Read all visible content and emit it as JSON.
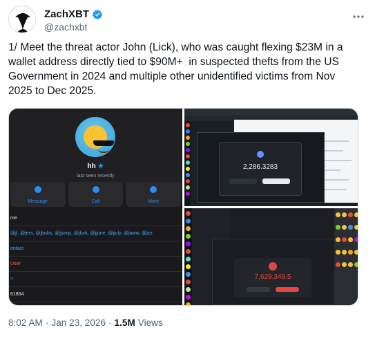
{
  "author": {
    "display_name": "ZachXBT",
    "handle": "@zachxbt",
    "verified": true,
    "avatar_icon": "detective-silhouette-icon"
  },
  "tweet": {
    "text": "1/ Meet the threat actor John (Lick), who was caught flexing $23M in a wallet address directly tied to $90M+  in suspected thefts from the US Government in 2024 and multiple other unidentified victims from Nov 2025 to Dec 2025."
  },
  "media": {
    "left_panel": {
      "profile_name": "hh",
      "status": "last seen recently",
      "actions": [
        "Message",
        "Call",
        "More"
      ],
      "rows": [
        "me",
        "@jl, @jers, @jbobs, @jjump, @jlurk, @jjune, @jjuly, @jaww, @jzz",
        "ontact",
        "User",
        ">",
        "61864"
      ]
    },
    "top_right": {
      "amount": "2,286.3283"
    },
    "bottom_right": {
      "amount": "7,629,349.5"
    },
    "colors": {
      "accent_blue": "#2a8cf0",
      "alert_red": "#e04646"
    }
  },
  "footer": {
    "time": "8:02 AM",
    "separator": "·",
    "date": "Jan 23, 2026",
    "separator2": "·",
    "views_count": "1.5M",
    "views_label": "Views"
  }
}
